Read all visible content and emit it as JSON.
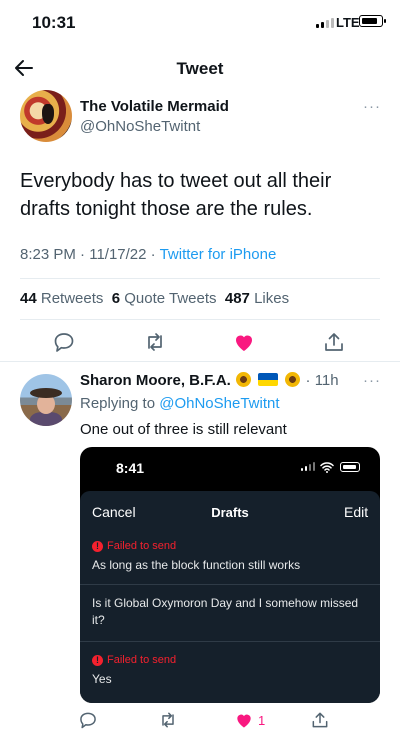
{
  "status_bar": {
    "time": "10:31",
    "network": "LTE"
  },
  "header": {
    "title": "Tweet",
    "back_icon": "arrow-left-icon"
  },
  "tweet": {
    "author_name": "The Volatile Mermaid",
    "author_handle": "@OhNoSheTwitnt",
    "more": "···",
    "text": "Everybody has to tweet out all their drafts tonight those are the rules.",
    "time": "8:23 PM",
    "date": "11/17/22",
    "source": "Twitter for iPhone",
    "stats": {
      "retweets_count": "44",
      "retweets_label": "Retweets",
      "quotes_count": "6",
      "quotes_label": "Quote Tweets",
      "likes_count": "487",
      "likes_label": "Likes"
    },
    "actions": [
      "reply-icon",
      "retweet-icon",
      "heart-icon",
      "share-icon"
    ]
  },
  "reply": {
    "author_name": "Sharon Moore, B.F.A.",
    "time": "11h",
    "more": "···",
    "replying_prefix": "Replying to",
    "replying_to": "@OhNoSheTwitnt",
    "text": "One out of three is still relevant",
    "like_count": "1",
    "embedded_screenshot": {
      "time": "8:41",
      "cancel": "Cancel",
      "title": "Drafts",
      "edit": "Edit",
      "drafts": [
        {
          "failed": "Failed to send",
          "text": "As long as the block function still works"
        },
        {
          "failed": "",
          "text": "Is it Global Oxymoron Day and I somehow missed it?"
        },
        {
          "failed": "Failed to send",
          "text": "Yes"
        }
      ]
    }
  },
  "colors": {
    "accent": "#1d9bf0",
    "like": "#f91880",
    "error": "#f4212e",
    "text": "#0f1419",
    "muted": "#536471"
  }
}
